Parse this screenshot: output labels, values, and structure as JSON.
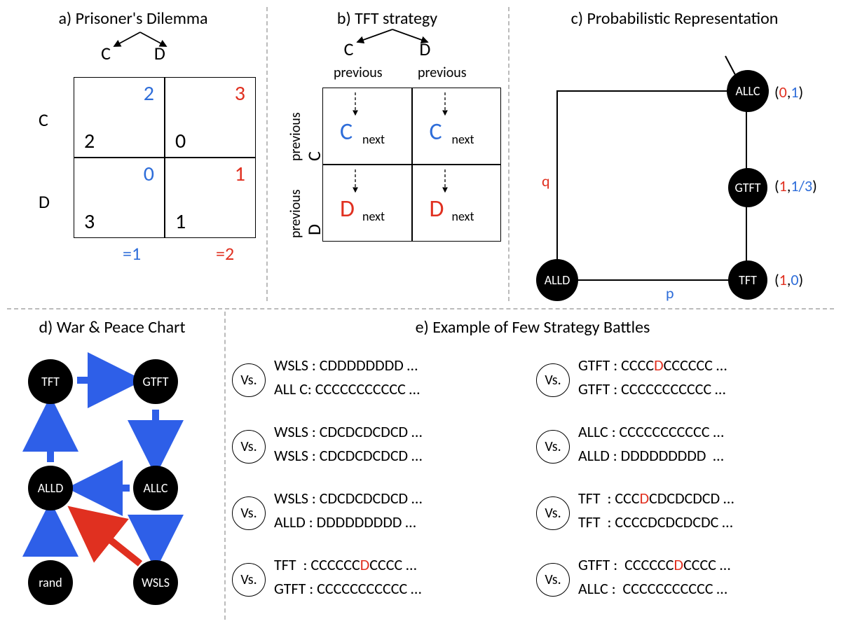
{
  "a": {
    "title": "a) Prisoner's Dilemma",
    "col_C": "C",
    "col_D": "D",
    "row_C": "C",
    "row_D": "D",
    "cells": {
      "cc": {
        "tr": "2",
        "bl": "2"
      },
      "cd": {
        "tr": "3",
        "bl": "0"
      },
      "dc": {
        "tr": "0",
        "bl": "3"
      },
      "dd": {
        "tr": "1",
        "bl": "1"
      }
    },
    "avg_C": "=1",
    "avg_D": "=2"
  },
  "b": {
    "title": "b) TFT strategy",
    "col_C": "C",
    "col_D": "D",
    "row_C": "C",
    "row_D": "D",
    "col_sub": "previous",
    "row_sub": "previous",
    "next": "next",
    "actions": {
      "tl": "C",
      "tr": "C",
      "bl": "D",
      "br": "D"
    }
  },
  "c": {
    "title": "c) Probabilistic Representation",
    "axis_p": "p",
    "axis_q": "q",
    "nodes": {
      "ALLC": {
        "label": "ALLC",
        "pq": [
          "0",
          "1"
        ]
      },
      "GTFT": {
        "label": "GTFT",
        "pq": [
          "1",
          "1/3"
        ]
      },
      "TFT": {
        "label": "TFT",
        "pq": [
          "1",
          "0"
        ]
      },
      "ALLD": {
        "label": "ALLD",
        "pq": null
      }
    }
  },
  "d": {
    "title": "d) War & Peace Chart",
    "nodes": [
      "TFT",
      "GTFT",
      "ALLD",
      "ALLC",
      "rand",
      "WSLS"
    ],
    "edges_blue": [
      [
        "rand",
        "ALLD"
      ],
      [
        "ALLD",
        "TFT"
      ],
      [
        "TFT",
        "GTFT"
      ],
      [
        "GTFT",
        "ALLC"
      ],
      [
        "ALLC",
        "ALLD"
      ],
      [
        "ALLC",
        "WSLS"
      ]
    ],
    "edges_red": [
      [
        "WSLS",
        "ALLD"
      ]
    ]
  },
  "e": {
    "title": "e) Example of Few Strategy Battles",
    "vs": "Vs.",
    "left": [
      {
        "a": "WSLS",
        "as": "CDDDDDDDD …",
        "b": "ALL C",
        "bs": "CCCCCCCCCCC …",
        "mutA": []
      },
      {
        "a": "WSLS",
        "as": "CDCDCDCDCD …",
        "b": "WSLS",
        "bs": "CDCDCDCDCD …",
        "mutA": []
      },
      {
        "a": "WSLS",
        "as": "CDCDCDCDCD …",
        "b": "ALLD ",
        "bs": "DDDDDDDDD …",
        "mutA": []
      },
      {
        "a": "TFT",
        "as": "CCCCCCDCCCC …",
        "b": "GTFT",
        "bs": "CCCCCCCCCCC …",
        "mutA": [
          6
        ]
      }
    ],
    "right": [
      {
        "a": "GTFT",
        "as": "CCCCDCCCCCC …",
        "b": "GTFT",
        "bs": "CCCCCCCCCCC …",
        "mutA": [
          4
        ]
      },
      {
        "a": "ALLC",
        "as": "CCCCCCCCCCC …",
        "b": "ALLD",
        "bs": "DDDDDDDDD  …",
        "mutA": []
      },
      {
        "a": "TFT",
        "as": "CCCDCDCDCDCD …",
        "b": "TFT",
        "bs": "CCCCDCDCDCDC …",
        "mutA": [
          3
        ],
        "mutB": []
      },
      {
        "a": "GTFT",
        "as": " CCCCCCDCCCC …",
        "b": "ALLC",
        "bs": " CCCCCCCCCCC …",
        "mutA": [
          7
        ]
      }
    ]
  },
  "chart_data": {
    "type": "table",
    "title": "Prisoner's Dilemma payoff matrix (row player payoff bl, column player payoff tr)",
    "rows": [
      "C",
      "D"
    ],
    "cols": [
      "C",
      "D"
    ],
    "row_payoff": [
      [
        2,
        0
      ],
      [
        3,
        1
      ]
    ],
    "col_payoff": [
      [
        2,
        3
      ],
      [
        0,
        1
      ]
    ],
    "column_average_col_payoff": {
      "C": 1,
      "D": 2
    }
  }
}
